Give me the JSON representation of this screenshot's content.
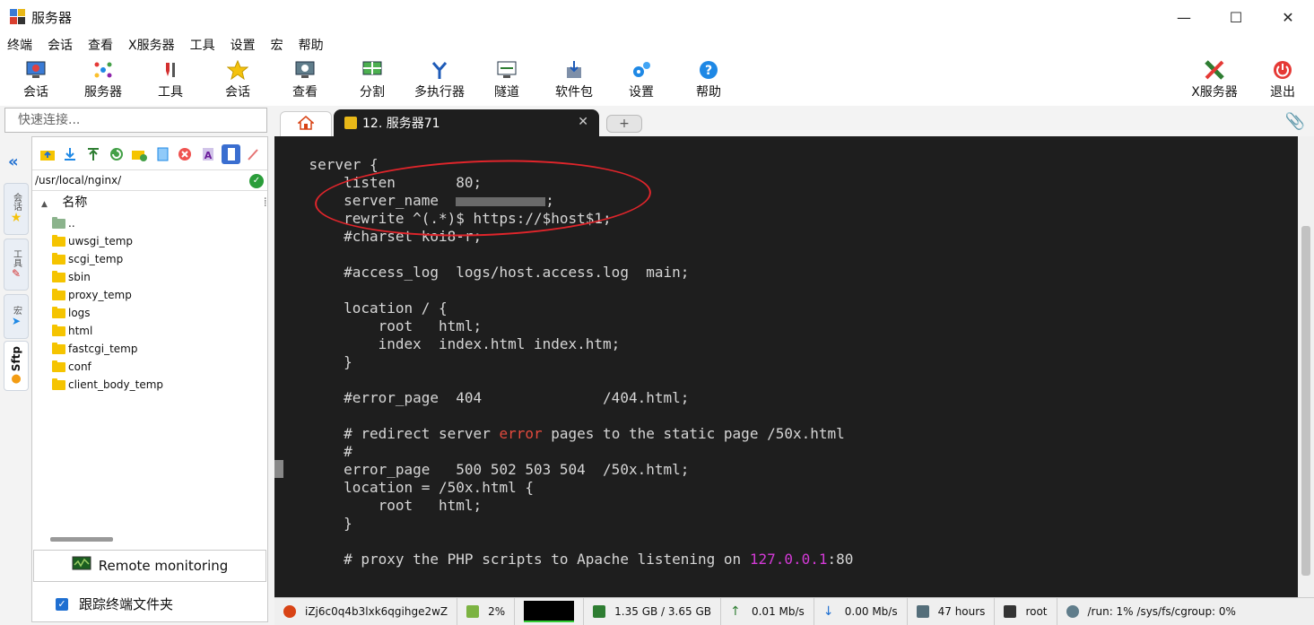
{
  "window": {
    "title": "服务器",
    "minimize": "—",
    "maximize": "☐",
    "close": "✕"
  },
  "menu": [
    "终端",
    "会话",
    "查看",
    "X服务器",
    "工具",
    "设置",
    "宏",
    "帮助"
  ],
  "toolbar": {
    "session": "会话",
    "servers": "服务器",
    "tools": "工具",
    "sessions2": "会话",
    "view": "查看",
    "split": "分割",
    "multiexec": "多执行器",
    "tunnel": "隧道",
    "packages": "软件包",
    "settings": "设置",
    "help": "帮助",
    "xserver": "X服务器",
    "exit": "退出"
  },
  "quick_connect": {
    "placeholder": "快速连接..."
  },
  "tabs": {
    "active_label": "12. 服务器71",
    "close": "✕",
    "new": "+"
  },
  "side_tabs": {
    "sessions": "会话",
    "tools": "工具",
    "macros": "宏",
    "sftp": "Sftp"
  },
  "sftp": {
    "path": "/usr/local/nginx/",
    "column_name": "名称",
    "items": [
      "..",
      "uwsgi_temp",
      "scgi_temp",
      "sbin",
      "proxy_temp",
      "logs",
      "html",
      "fastcgi_temp",
      "conf",
      "client_body_temp"
    ],
    "remote_monitoring": "Remote monitoring",
    "follow_terminal": "跟踪终端文件夹"
  },
  "terminal": {
    "lines": [
      "    server {",
      "        listen       80;",
      "        server_name  ",
      "        rewrite ^(.*)$ https://$host$1;",
      "        #charset koi8-r;",
      "",
      "        #access_log  logs/host.access.log  main;",
      "",
      "        location / {",
      "            root   html;",
      "            index  index.html index.htm;",
      "        }",
      "",
      "        #error_page  404              /404.html;",
      "",
      "        # redirect server ",
      "        #",
      "        error_page   500 502 503 504  /50x.html;",
      "        location = /50x.html {",
      "            root   html;",
      "        }",
      "",
      "        # proxy the PHP scripts to Apache listening on "
    ],
    "server_name_tail": ";",
    "error_word": "error",
    "error_rest": " pages to the static page /50x.html",
    "ip": "127.0.0.1",
    "ip_tail": ":80"
  },
  "status": {
    "host": "iZj6c0q4b3lxk6qgihge2wZ",
    "cpu": "2%",
    "memory": "1.35 GB / 3.65 GB",
    "upload": "0.01 Mb/s",
    "download": "0.00 Mb/s",
    "uptime": "47 hours",
    "user": "root",
    "disk": "/run: 1%   /sys/fs/cgroup: 0%"
  }
}
